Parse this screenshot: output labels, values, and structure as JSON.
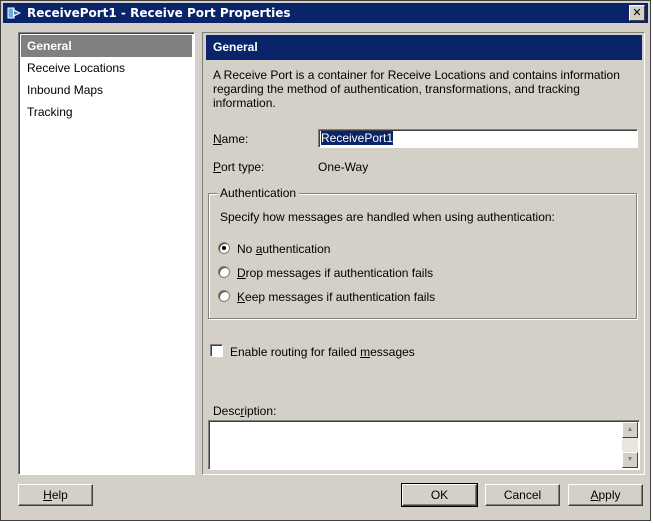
{
  "window": {
    "title": "ReceivePort1 - Receive Port Properties",
    "close_glyph": "✕"
  },
  "nav": {
    "items": [
      {
        "label": "General",
        "selected": true
      },
      {
        "label": "Receive Locations",
        "selected": false
      },
      {
        "label": "Inbound Maps",
        "selected": false
      },
      {
        "label": "Tracking",
        "selected": false
      }
    ]
  },
  "general": {
    "header": "General",
    "intro": "A Receive Port is a container for Receive Locations and contains information regarding the method of authentication, transformations, and tracking information.",
    "name_label": "Name:",
    "name_value": "ReceivePort1",
    "port_type_label": "Port type:",
    "port_type_value": "One-Way",
    "authentication": {
      "legend": "Authentication",
      "description": "Specify how messages are handled when using authentication:",
      "options": [
        {
          "label": "No authentication",
          "selected": true
        },
        {
          "label": "Drop messages if authentication fails",
          "selected": false
        },
        {
          "label": "Keep messages if authentication fails",
          "selected": false
        }
      ]
    },
    "routing_checkbox_label": "Enable routing for failed messages",
    "routing_checked": false,
    "description_label": "Description:",
    "description_value": ""
  },
  "buttons": {
    "help": "Help",
    "ok": "OK",
    "cancel": "Cancel",
    "apply": "Apply"
  }
}
